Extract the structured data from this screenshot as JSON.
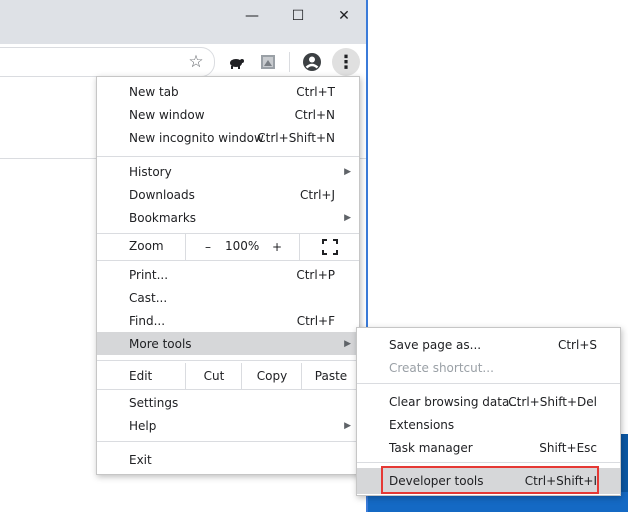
{
  "window": {
    "minimize_glyph": "—",
    "maximize_glyph": "☐",
    "close_glyph": "✕"
  },
  "toolbar": {
    "bookmark_star": "☆",
    "profile_icon": "profile-icon",
    "menu_dots": "⋮"
  },
  "menu": {
    "new_tab": {
      "label": "New tab",
      "shortcut": "Ctrl+T"
    },
    "new_window": {
      "label": "New window",
      "shortcut": "Ctrl+N"
    },
    "new_incognito": {
      "label": "New incognito window",
      "shortcut": "Ctrl+Shift+N"
    },
    "history": {
      "label": "History"
    },
    "downloads": {
      "label": "Downloads",
      "shortcut": "Ctrl+J"
    },
    "bookmarks": {
      "label": "Bookmarks"
    },
    "zoom": {
      "label": "Zoom",
      "minus": "–",
      "value": "100%",
      "plus": "+"
    },
    "print": {
      "label": "Print...",
      "shortcut": "Ctrl+P"
    },
    "cast": {
      "label": "Cast..."
    },
    "find": {
      "label": "Find...",
      "shortcut": "Ctrl+F"
    },
    "more_tools": {
      "label": "More tools"
    },
    "edit": {
      "label": "Edit",
      "cut": "Cut",
      "copy": "Copy",
      "paste": "Paste"
    },
    "settings": {
      "label": "Settings"
    },
    "help": {
      "label": "Help"
    },
    "exit": {
      "label": "Exit"
    }
  },
  "submenu": {
    "save_page": {
      "label": "Save page as...",
      "shortcut": "Ctrl+S"
    },
    "create_shortcut": {
      "label": "Create shortcut..."
    },
    "clear_browsing": {
      "label": "Clear browsing data...",
      "shortcut": "Ctrl+Shift+Del"
    },
    "extensions": {
      "label": "Extensions"
    },
    "task_manager": {
      "label": "Task manager",
      "shortcut": "Shift+Esc"
    },
    "developer_tools": {
      "label": "Developer tools",
      "shortcut": "Ctrl+Shift+I"
    }
  },
  "colors": {
    "highlight": "#d6d7d9",
    "annotation_red": "#e53935",
    "window_edge": "#3b7bd9"
  }
}
